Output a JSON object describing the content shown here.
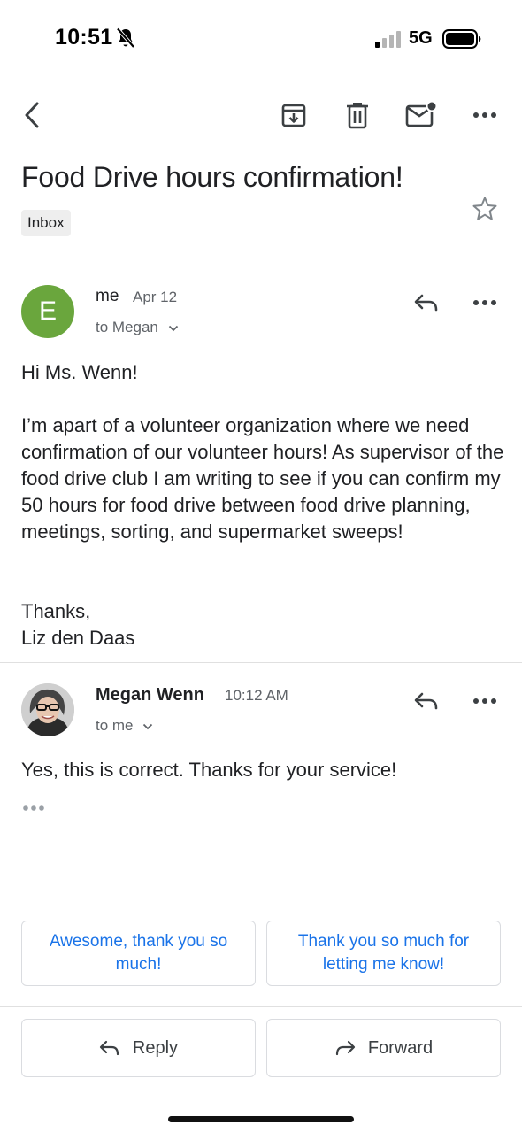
{
  "status_bar": {
    "time": "10:51",
    "network": "5G",
    "icons": [
      "bell-slash-icon",
      "signal-icon",
      "battery-icon"
    ]
  },
  "toolbar": {
    "icons": [
      "back-arrow-icon",
      "archive-icon",
      "trash-icon",
      "mark-unread-icon",
      "more-icon"
    ]
  },
  "thread": {
    "subject": "Food Drive hours confirmation!",
    "label": "Inbox",
    "star_icon": "star-outline-icon"
  },
  "messages": [
    {
      "avatar_letter": "E",
      "avatar_color": "#6aa63d",
      "sender": "me",
      "date": "Apr 12",
      "recipients": "to Megan",
      "greeting": "Hi Ms. Wenn!",
      "body": "I’m apart of a volunteer organization where we need confirmation of our volunteer hours! As supervisor of the food drive club I am writing to see if you can confirm my 50 hours for food drive between food drive planning, meetings, sorting, and supermarket sweeps!",
      "signoff": "Thanks,",
      "signature": "Liz den Daas"
    },
    {
      "sender": "Megan Wenn",
      "date": "10:12 AM",
      "recipients": "to me",
      "body": "Yes, this is correct. Thanks for your service!"
    }
  ],
  "smart_replies": [
    "Awesome, thank you so much!",
    "Thank you so much for letting me know!"
  ],
  "actions": {
    "reply": "Reply",
    "forward": "Forward"
  },
  "colors": {
    "accent": "#1a73e8",
    "text": "#202124",
    "secondary": "#5f6368"
  }
}
